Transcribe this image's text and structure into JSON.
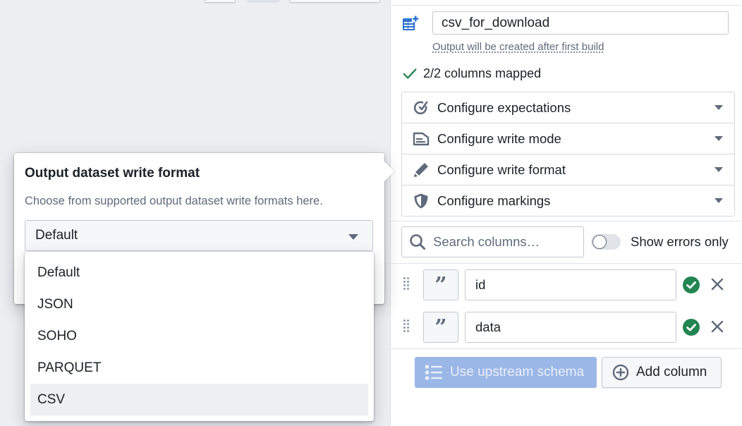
{
  "toolbar": {
    "stubs": [
      "toolbar-button-1",
      "toolbar-button-2",
      "toolbar-button-3"
    ]
  },
  "output": {
    "name_value": "csv_for_download",
    "helper_text": "Output will be created after first build",
    "mapped_status": "2/2 columns mapped",
    "icon": "table-add-icon"
  },
  "config_sections": [
    {
      "label": "Configure expectations",
      "icon": "expectations-icon"
    },
    {
      "label": "Configure write mode",
      "icon": "write-mode-icon"
    },
    {
      "label": "Configure write format",
      "icon": "pencil-icon"
    },
    {
      "label": "Configure markings",
      "icon": "shield-icon"
    }
  ],
  "columns_toolbar": {
    "search_placeholder": "Search columns…",
    "search_value": "",
    "toggle_label": "Show errors only",
    "toggle_on": false
  },
  "columns": [
    {
      "name": "id",
      "type_icon": "string-type-icon",
      "status": "valid"
    },
    {
      "name": "data",
      "type_icon": "string-type-icon",
      "status": "valid"
    }
  ],
  "actions": {
    "use_upstream_label": "Use upstream schema",
    "use_upstream_disabled": true,
    "add_column_label": "Add column"
  },
  "popover": {
    "title": "Output dataset write format",
    "description": "Choose from supported output dataset write formats here.",
    "selected_value": "Default",
    "options": [
      "Default",
      "JSON",
      "SOHO",
      "PARQUET",
      "CSV"
    ],
    "highlighted_option": "CSV"
  },
  "colors": {
    "accent_blue": "#2d72d2",
    "success_green": "#238551",
    "disabled_button": "#9bb7e7",
    "muted_text": "#5f6b7c"
  }
}
